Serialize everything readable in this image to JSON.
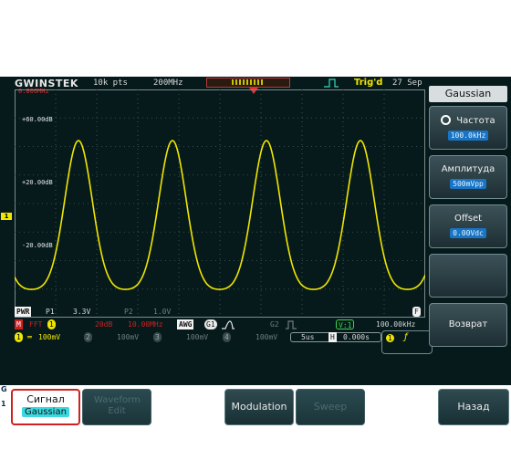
{
  "topbar": {
    "logo": "GWINSTEK",
    "logo_sub": "0.800MHz",
    "record_length": "10k pts",
    "sample_rate": "200MHz",
    "trigger_status": "Trig'd",
    "date": "27 Sep"
  },
  "graticule": {
    "y_labels": [
      "+60.00dB",
      "+20.00dB",
      "-20.00dB"
    ],
    "ch1_marker": "1"
  },
  "status_rows": {
    "pwr_label": "PWR",
    "p1_label": "P1",
    "p1_value": "3.3V",
    "p2_label": "P2",
    "p2_value": "1.0V",
    "f_label": "F",
    "m_label": "M",
    "fft_label": "FFT",
    "fft_ch": "1",
    "fft_db": "20dB",
    "fft_freq": "10.00MHz",
    "awg_label": "AWG",
    "awg_g1": "G1",
    "awg_g2": "G2",
    "v_label": "V:1",
    "frequency": "100.00kHz",
    "ch1_num": "1",
    "ch1_scale": "100mV",
    "ch2_num": "2",
    "ch2_scale": "100mV",
    "ch3_num": "3",
    "ch3_scale": "100mV",
    "ch4_num": "4",
    "ch4_scale": "100mV",
    "timebase": "5us",
    "h_label": "H",
    "h_pos": "0.000s",
    "trig_ch": "1"
  },
  "menu": {
    "title": "Gaussian",
    "frequency_label": "Частота",
    "frequency_value": "100.0kHz",
    "amplitude_label": "Амплитуда",
    "amplitude_value": "500mVpp",
    "offset_label": "Offset",
    "offset_value": "0.00Vdc",
    "back_label": "Возврат"
  },
  "softkeys": {
    "signal_label": "Сигнал",
    "signal_value": "Gaussian",
    "waveform_edit": "Waveform Edit",
    "modulation": "Modulation",
    "sweep": "Sweep",
    "back": "Назад"
  },
  "side_letters": [
    "G",
    "1"
  ],
  "colors": {
    "trace": "#f0e600",
    "screen_bg": "#061a1c",
    "accent_blue": "#1874c4",
    "selected_border": "#d02020"
  },
  "chart_data": {
    "type": "line",
    "ylabels": [
      "+60.00dB",
      "+20.00dB",
      "-20.00dB"
    ],
    "peaks": 4,
    "series": [
      {
        "values": [
          -45,
          70,
          -45,
          70,
          -45,
          70,
          -45,
          70,
          -45
        ]
      }
    ]
  }
}
